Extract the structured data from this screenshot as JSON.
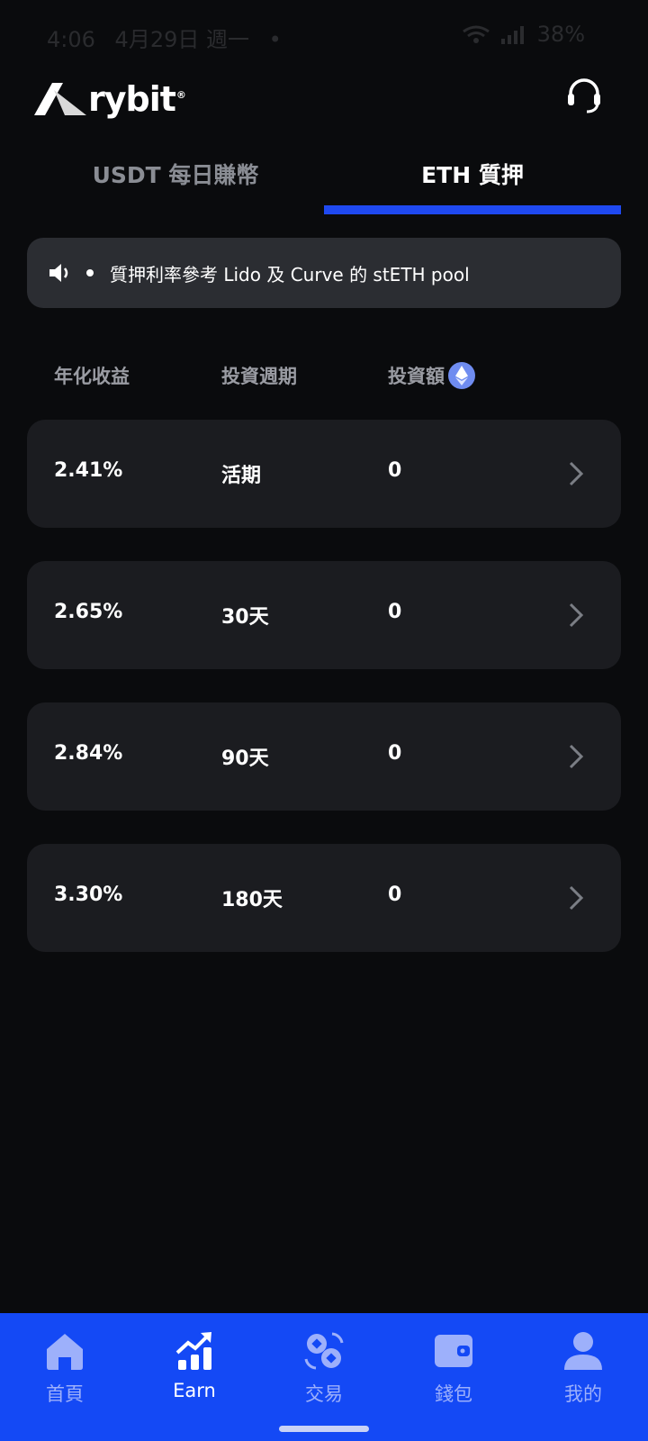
{
  "status": {
    "time": "4:06",
    "date": "4月29日 週一",
    "dot": "•",
    "battery": "38%"
  },
  "app": {
    "name": "rybit",
    "reg": "®"
  },
  "tabs": [
    {
      "label": "USDT 每日賺幣",
      "active": false
    },
    {
      "label": "ETH 質押",
      "active": true
    }
  ],
  "notice": {
    "icon": "speaker-icon",
    "text": "質押利率參考 Lido 及 Curve 的 stETH pool"
  },
  "columns": {
    "apy": "年化收益",
    "period": "投資週期",
    "amount": "投資額",
    "amount_icon": "eth-icon"
  },
  "products": [
    {
      "apy": "2.41%",
      "period": "活期",
      "amount": "0"
    },
    {
      "apy": "2.65%",
      "period": "30天",
      "amount": "0"
    },
    {
      "apy": "2.84%",
      "period": "90天",
      "amount": "0"
    },
    {
      "apy": "3.30%",
      "period": "180天",
      "amount": "0"
    }
  ],
  "nav": [
    {
      "label": "首頁",
      "icon": "home-icon",
      "active": false
    },
    {
      "label": "Earn",
      "icon": "earn-icon",
      "active": true
    },
    {
      "label": "交易",
      "icon": "trade-icon",
      "active": false
    },
    {
      "label": "錢包",
      "icon": "wallet-icon",
      "active": false
    },
    {
      "label": "我的",
      "icon": "profile-icon",
      "active": false
    }
  ],
  "colors": {
    "accent": "#1f49f0",
    "nav_bg": "#1449f5",
    "card_bg": "#1b1c20",
    "page_bg": "#0a0b0d"
  }
}
